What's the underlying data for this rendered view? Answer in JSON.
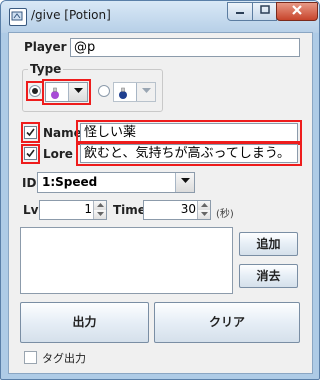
{
  "window": {
    "title": "/give [Potion]"
  },
  "player": {
    "label": "Player",
    "value": "@p"
  },
  "type_group": {
    "title": "Type",
    "option1_selected": true,
    "option2_selected": false,
    "potion1_color": "#a84bd6",
    "potion2_color": "#1f3f8f"
  },
  "name": {
    "label": "Name",
    "checked": true,
    "value": "怪しい薬"
  },
  "lore": {
    "label": "Lore",
    "checked": true,
    "value": "飲むと、気持ちが高ぶってしまう。"
  },
  "id": {
    "label": "ID",
    "value": "1:Speed"
  },
  "lv": {
    "label": "Lv",
    "value": "1"
  },
  "time": {
    "label": "Time",
    "value": "30",
    "unit": "(秒)"
  },
  "buttons": {
    "add": "追加",
    "delete": "消去",
    "output": "出力",
    "clear": "クリア"
  },
  "tag_output": {
    "label": "タグ出力",
    "checked": false
  }
}
